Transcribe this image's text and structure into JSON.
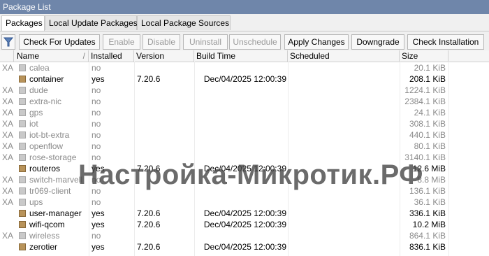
{
  "window": {
    "title": "Package List"
  },
  "tabs": [
    "Packages",
    "Local Update Packages",
    "Local Package Sources"
  ],
  "toolbar": {
    "filter_icon": "filter-icon",
    "buttons": [
      {
        "label": "Check For Updates",
        "enabled": true
      },
      {
        "label": "Enable",
        "enabled": false
      },
      {
        "label": "Disable",
        "enabled": false
      },
      {
        "label": "Uninstall",
        "enabled": false
      },
      {
        "label": "Unschedule",
        "enabled": false
      },
      {
        "label": "Apply Changes",
        "enabled": true
      },
      {
        "label": "Downgrade",
        "enabled": true
      },
      {
        "label": "Check Installation",
        "enabled": true
      }
    ]
  },
  "columns": [
    "Name",
    "Installed",
    "Version",
    "Build Time",
    "Scheduled",
    "Size"
  ],
  "packages": [
    {
      "flags": "XA",
      "name": "calea",
      "installed": "no",
      "version": "",
      "build_time": "",
      "scheduled": "",
      "size": "20.1 KiB",
      "active": false
    },
    {
      "flags": "",
      "name": "container",
      "installed": "yes",
      "version": "7.20.6",
      "build_time": "Dec/04/2025 12:00:39",
      "scheduled": "",
      "size": "208.1 KiB",
      "active": true
    },
    {
      "flags": "XA",
      "name": "dude",
      "installed": "no",
      "version": "",
      "build_time": "",
      "scheduled": "",
      "size": "1224.1 KiB",
      "active": false
    },
    {
      "flags": "XA",
      "name": "extra-nic",
      "installed": "no",
      "version": "",
      "build_time": "",
      "scheduled": "",
      "size": "2384.1 KiB",
      "active": false
    },
    {
      "flags": "XA",
      "name": "gps",
      "installed": "no",
      "version": "",
      "build_time": "",
      "scheduled": "",
      "size": "24.1 KiB",
      "active": false
    },
    {
      "flags": "XA",
      "name": "iot",
      "installed": "no",
      "version": "",
      "build_time": "",
      "scheduled": "",
      "size": "308.1 KiB",
      "active": false
    },
    {
      "flags": "XA",
      "name": "iot-bt-extra",
      "installed": "no",
      "version": "",
      "build_time": "",
      "scheduled": "",
      "size": "440.1 KiB",
      "active": false
    },
    {
      "flags": "XA",
      "name": "openflow",
      "installed": "no",
      "version": "",
      "build_time": "",
      "scheduled": "",
      "size": "80.1 KiB",
      "active": false
    },
    {
      "flags": "XA",
      "name": "rose-storage",
      "installed": "no",
      "version": "",
      "build_time": "",
      "scheduled": "",
      "size": "3140.1 KiB",
      "active": false
    },
    {
      "flags": "",
      "name": "routeros",
      "installed": "yes",
      "version": "7.20.6",
      "build_time": "Dec/04/2025 12:00:39",
      "scheduled": "",
      "size": "12.6 MiB",
      "active": true
    },
    {
      "flags": "XA",
      "name": "switch-marvell",
      "installed": "no",
      "version": "",
      "build_time": "",
      "scheduled": "",
      "size": "8.8 MiB",
      "active": false
    },
    {
      "flags": "XA",
      "name": "tr069-client",
      "installed": "no",
      "version": "",
      "build_time": "",
      "scheduled": "",
      "size": "136.1 KiB",
      "active": false
    },
    {
      "flags": "XA",
      "name": "ups",
      "installed": "no",
      "version": "",
      "build_time": "",
      "scheduled": "",
      "size": "36.1 KiB",
      "active": false
    },
    {
      "flags": "",
      "name": "user-manager",
      "installed": "yes",
      "version": "7.20.6",
      "build_time": "Dec/04/2025 12:00:39",
      "scheduled": "",
      "size": "336.1 KiB",
      "active": true
    },
    {
      "flags": "",
      "name": "wifi-qcom",
      "installed": "yes",
      "version": "7.20.6",
      "build_time": "Dec/04/2025 12:00:39",
      "scheduled": "",
      "size": "10.2 MiB",
      "active": true
    },
    {
      "flags": "XA",
      "name": "wireless",
      "installed": "no",
      "version": "",
      "build_time": "",
      "scheduled": "",
      "size": "864.1 KiB",
      "active": false
    },
    {
      "flags": "",
      "name": "zerotier",
      "installed": "yes",
      "version": "7.20.6",
      "build_time": "Dec/04/2025 12:00:39",
      "scheduled": "",
      "size": "836.1 KiB",
      "active": true
    }
  ],
  "watermark": "Настройка-Микротик.РФ",
  "colors": {
    "titlebar": "#6f86aa",
    "inactive_text": "#8a8a8a",
    "package_icon": "#b8935a"
  }
}
